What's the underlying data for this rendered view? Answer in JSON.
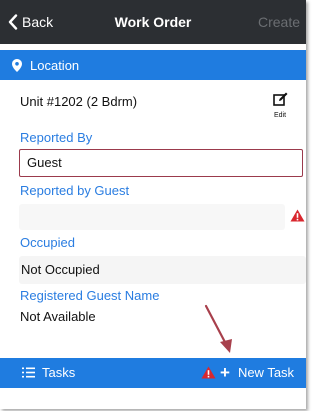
{
  "navbar": {
    "back_label": "Back",
    "title": "Work Order",
    "create_label": "Create"
  },
  "location": {
    "header_label": "Location",
    "icon": "map-pin-icon",
    "unit": "Unit #1202 (2 Bdrm)",
    "edit_label": "Edit"
  },
  "form": {
    "reported_by_label": "Reported By",
    "reported_by_value": "Guest",
    "reported_by_guest_label": "Reported by Guest",
    "reported_by_guest_value": "",
    "occupied_label": "Occupied",
    "occupied_value": "Not Occupied",
    "registered_guest_label": "Registered Guest Name",
    "registered_guest_value": "Not Available"
  },
  "tasks": {
    "header_label": "Tasks",
    "new_task_label": "New Task"
  },
  "colors": {
    "navbar_bg": "#2c2f33",
    "accent_blue": "#1f7ce0",
    "label_blue": "#2a7de1",
    "warning_red": "#d9272e",
    "field_border": "#9b3a4c",
    "annotation_arrow": "#a8404c"
  }
}
